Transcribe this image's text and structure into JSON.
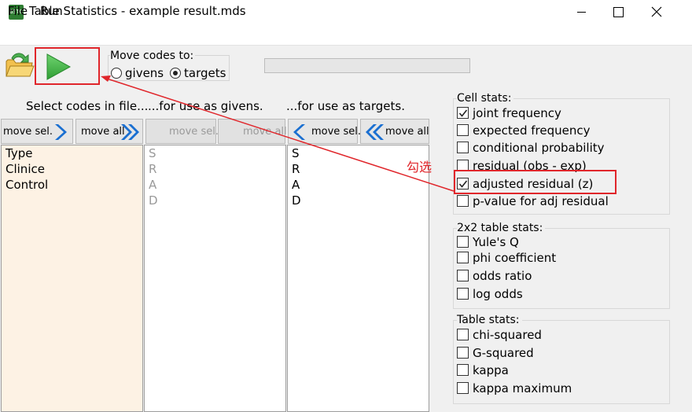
{
  "window": {
    "title": "Table Statistics - example result.mds",
    "app_icon": "gsto-icon",
    "app_icon_text": "GSTO"
  },
  "menu": [
    "File",
    "Run"
  ],
  "toolbar": {
    "move_codes_label": "Move codes to:",
    "radio_givens": "givens",
    "radio_targets": "targets",
    "selected": "targets",
    "progress": 0
  },
  "columns": {
    "file_heading": "Select codes in file...",
    "givens_heading": "...for use as givens.",
    "targets_heading": "...for use as targets.",
    "move_sel": "move sel.",
    "move_all": "move all"
  },
  "lists": {
    "file": [
      "Type",
      "Clinice",
      "Control"
    ],
    "givens": [
      "S",
      "R",
      "A",
      "D"
    ],
    "targets": [
      "S",
      "R",
      "A",
      "D"
    ]
  },
  "cell_stats": {
    "label": "Cell stats:",
    "items": [
      {
        "label": "joint frequency",
        "checked": true
      },
      {
        "label": "expected frequency",
        "checked": false
      },
      {
        "label": "conditional probability",
        "checked": false
      },
      {
        "label": "residual (obs - exp)",
        "checked": false
      },
      {
        "label": "adjusted residual (z)",
        "checked": true
      },
      {
        "label": "p-value for adj residual",
        "checked": false
      }
    ]
  },
  "stats_2x2": {
    "label": "2x2 table stats:",
    "items": [
      {
        "label": "Yule's Q",
        "checked": false
      },
      {
        "label": "phi coefficient",
        "checked": false
      },
      {
        "label": "odds ratio",
        "checked": false
      },
      {
        "label": "log odds",
        "checked": false
      }
    ]
  },
  "table_stats": {
    "label": "Table stats:",
    "items": [
      {
        "label": "chi-squared",
        "checked": false
      },
      {
        "label": "G-squared",
        "checked": false
      },
      {
        "label": "kappa",
        "checked": false
      },
      {
        "label": "kappa maximum",
        "checked": false
      }
    ]
  },
  "annotation": {
    "text": "勾选",
    "color": "#e0262b"
  },
  "colors": {
    "accent": "#e0262b",
    "run_green": "#3cb043",
    "file_list_bg": "#fdf2e4",
    "arrow_blue": "#1a6fd1"
  }
}
